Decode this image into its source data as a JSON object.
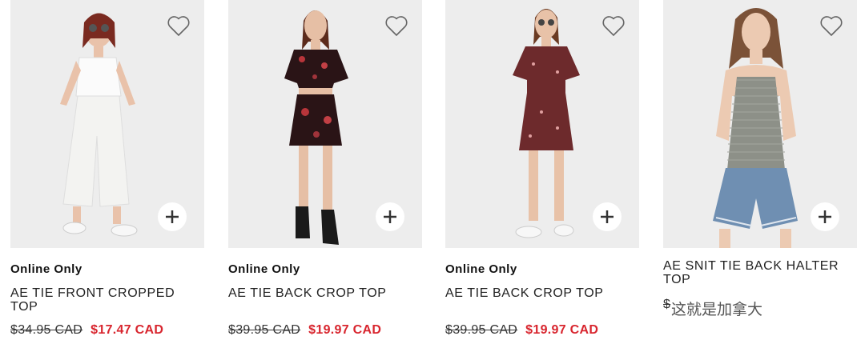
{
  "products": [
    {
      "badge": "Online Only",
      "name": "AE TIE FRONT CROPPED TOP",
      "old_price": "$34.95 CAD",
      "sale_price": "$17.47 CAD",
      "favorite_icon": "heart-outline-icon",
      "add_icon": "plus-icon"
    },
    {
      "badge": "Online Only",
      "name": "AE TIE BACK CROP TOP",
      "old_price": "$39.95 CAD",
      "sale_price": "$19.97 CAD",
      "favorite_icon": "heart-outline-icon",
      "add_icon": "plus-icon"
    },
    {
      "badge": "Online Only",
      "name": "AE TIE BACK CROP TOP",
      "old_price": "$39.95 CAD",
      "sale_price": "$19.97 CAD",
      "favorite_icon": "heart-outline-icon",
      "add_icon": "plus-icon"
    },
    {
      "badge": "",
      "name": "AE SNIT TIE BACK HALTER TOP",
      "old_price": "$",
      "sale_price": "",
      "favorite_icon": "heart-outline-icon",
      "add_icon": "plus-icon"
    }
  ],
  "watermark": "这就是加拿大",
  "colors": {
    "sale": "#d8252e",
    "photo_bg": "#ededed"
  }
}
